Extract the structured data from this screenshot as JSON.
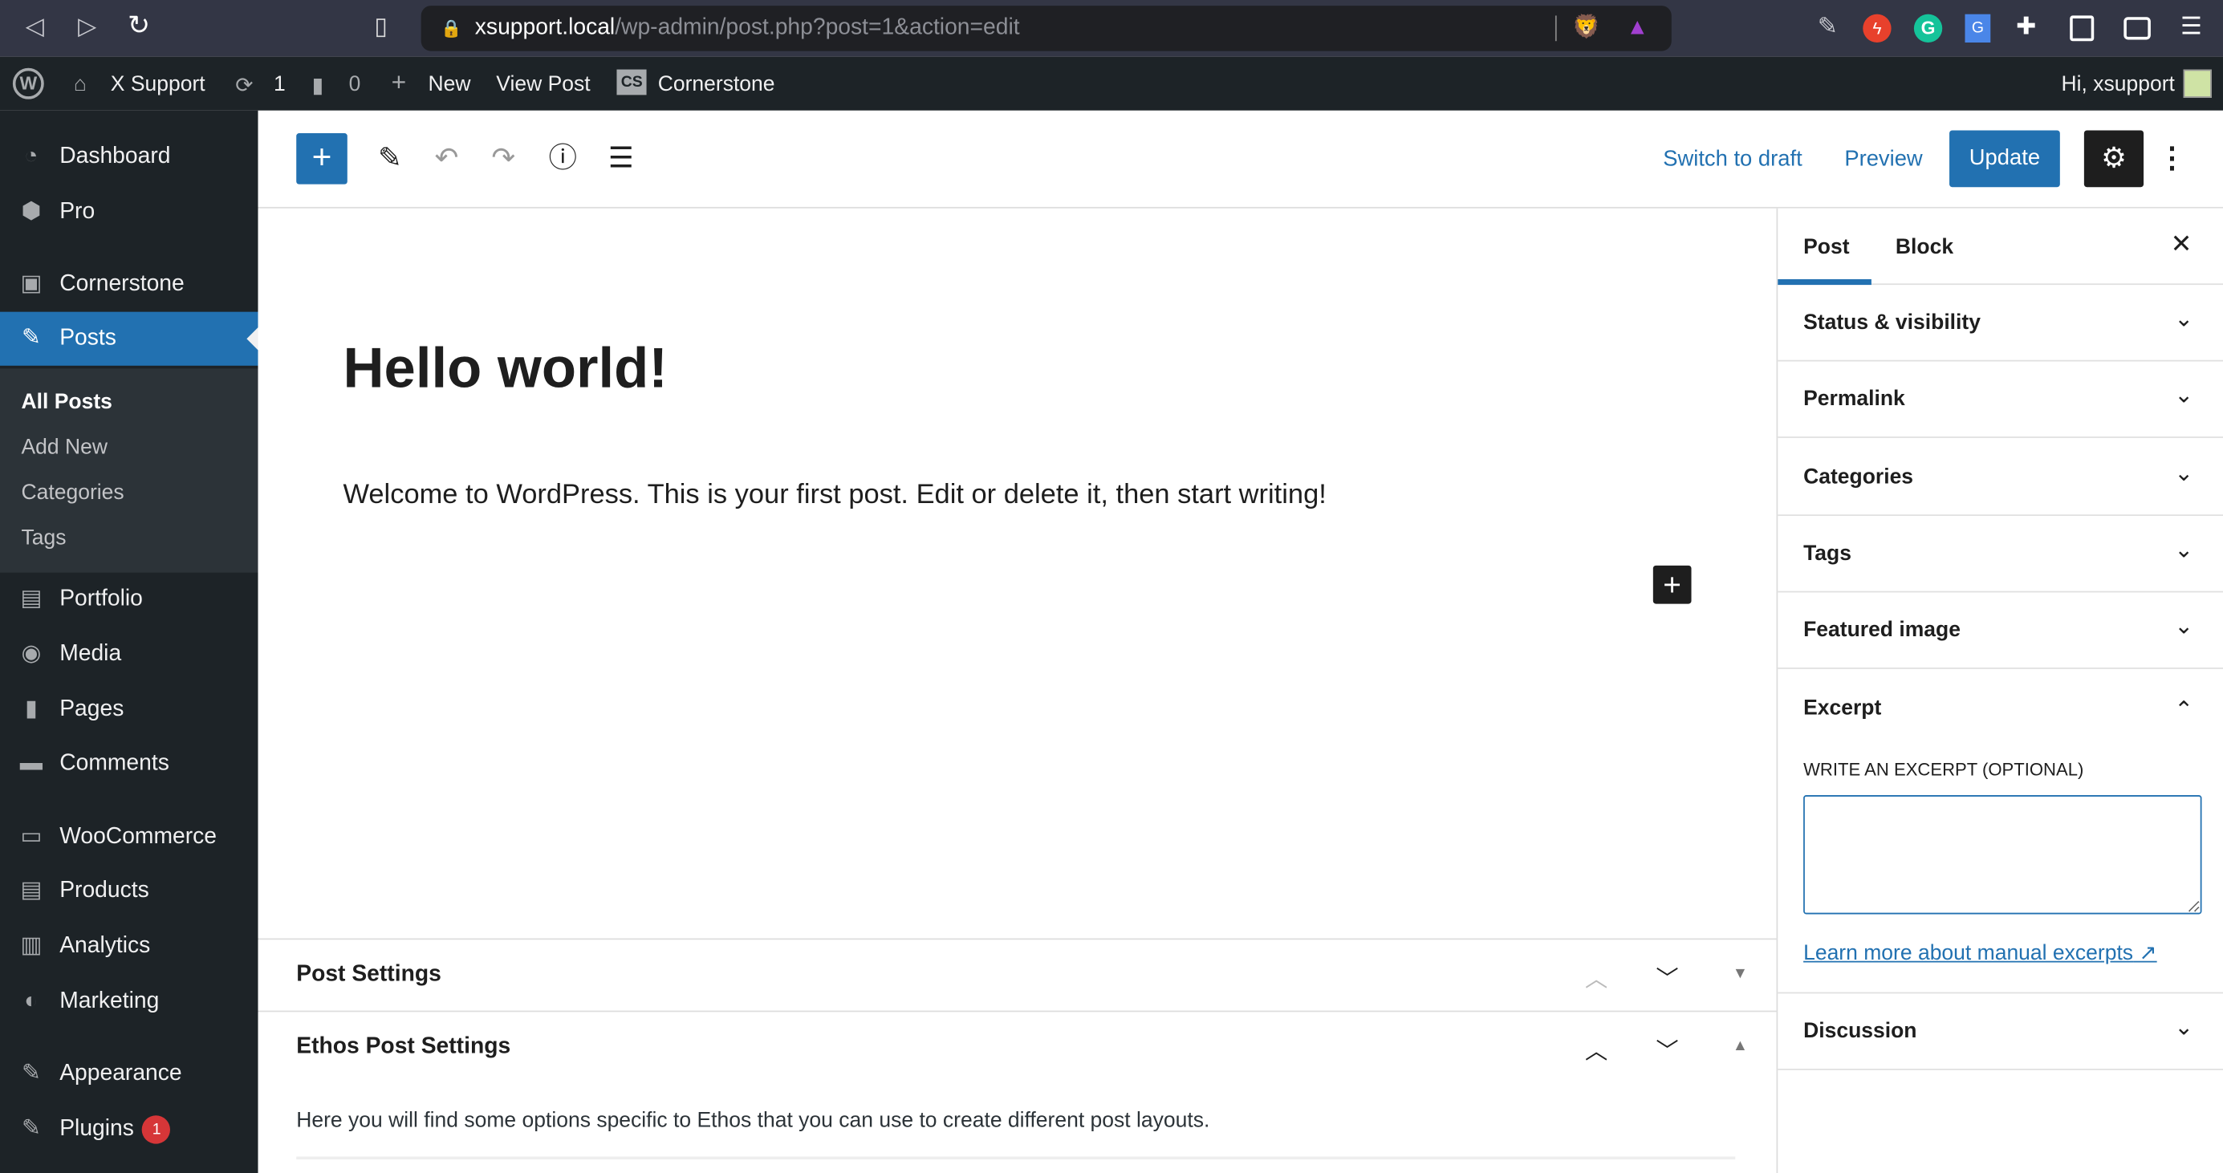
{
  "browser": {
    "url_host": "xsupport.local",
    "url_path": "/wp-admin/post.php?post=1&action=edit"
  },
  "adminbar": {
    "site": "X Support",
    "updates": "1",
    "comments": "0",
    "new": "New",
    "view_post": "View Post",
    "cornerstone": "Cornerstone",
    "cs_badge": "CS",
    "greeting": "Hi, xsupport"
  },
  "sidebar": {
    "items": [
      {
        "label": "Dashboard",
        "icon": "dashboard-icon"
      },
      {
        "label": "Pro",
        "icon": "pro-icon"
      },
      {
        "label": "Cornerstone",
        "icon": "cornerstone-icon"
      },
      {
        "label": "Posts",
        "icon": "pin-icon"
      },
      {
        "label": "Portfolio",
        "icon": "portfolio-icon"
      },
      {
        "label": "Media",
        "icon": "media-icon"
      },
      {
        "label": "Pages",
        "icon": "pages-icon"
      },
      {
        "label": "Comments",
        "icon": "comments-icon"
      },
      {
        "label": "WooCommerce",
        "icon": "woocommerce-icon"
      },
      {
        "label": "Products",
        "icon": "products-icon"
      },
      {
        "label": "Analytics",
        "icon": "analytics-icon"
      },
      {
        "label": "Marketing",
        "icon": "marketing-icon"
      },
      {
        "label": "Appearance",
        "icon": "appearance-icon"
      },
      {
        "label": "Plugins",
        "icon": "plugins-icon",
        "badge": "1"
      }
    ],
    "submenu": [
      "All Posts",
      "Add New",
      "Categories",
      "Tags"
    ]
  },
  "toolbar": {
    "switch_draft": "Switch to draft",
    "preview": "Preview",
    "update": "Update"
  },
  "editor": {
    "title": "Hello world!",
    "paragraph": "Welcome to WordPress. This is your first post. Edit or delete it, then start writing!"
  },
  "meta_boxes": [
    {
      "title": "Post Settings"
    },
    {
      "title": "Ethos Post Settings",
      "description": "Here you will find some options specific to Ethos that you can use to create different post layouts."
    }
  ],
  "settings_panel": {
    "tabs": [
      "Post",
      "Block"
    ],
    "sections": [
      "Status & visibility",
      "Permalink",
      "Categories",
      "Tags",
      "Featured image",
      "Excerpt",
      "Discussion"
    ],
    "excerpt_label": "WRITE AN EXCERPT (OPTIONAL)",
    "excerpt_value": "",
    "excerpt_link": "Learn more about manual excerpts"
  },
  "colors": {
    "accent": "#2271b1",
    "admin_bg": "#1d2327",
    "badge": "#d63638"
  }
}
